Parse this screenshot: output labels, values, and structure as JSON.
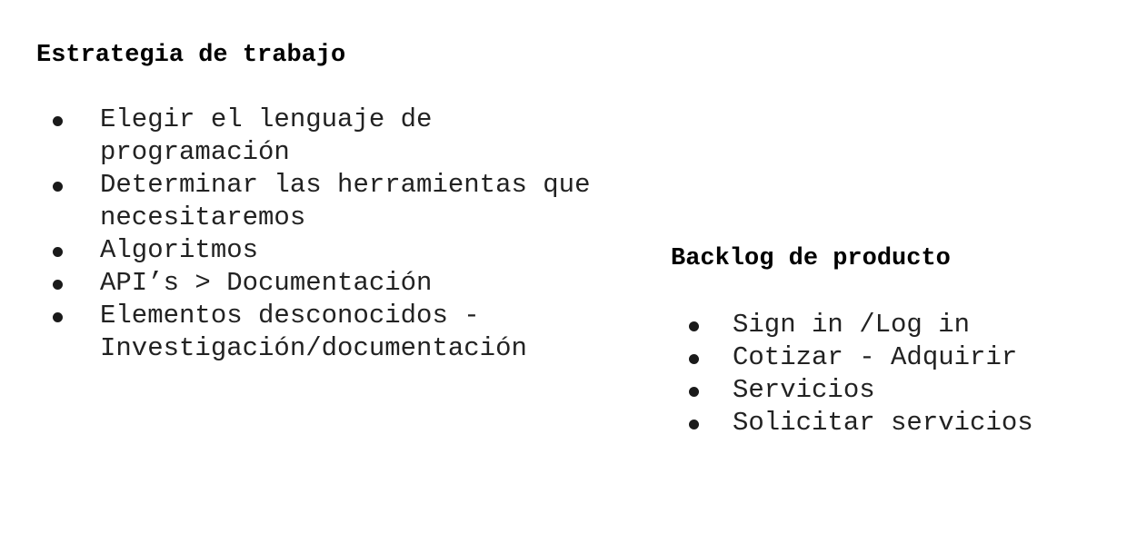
{
  "left": {
    "heading": "Estrategia de trabajo",
    "items": [
      "Elegir el lenguaje de programación",
      "Determinar las herramientas que necesitaremos",
      "Algoritmos",
      "API’s > Documentación",
      "Elementos desconocidos - Investigación/documentación"
    ]
  },
  "right": {
    "heading": "Backlog de producto",
    "items": [
      "Sign in /Log in",
      "Cotizar - Adquirir",
      "Servicios",
      "Solicitar servicios"
    ]
  }
}
